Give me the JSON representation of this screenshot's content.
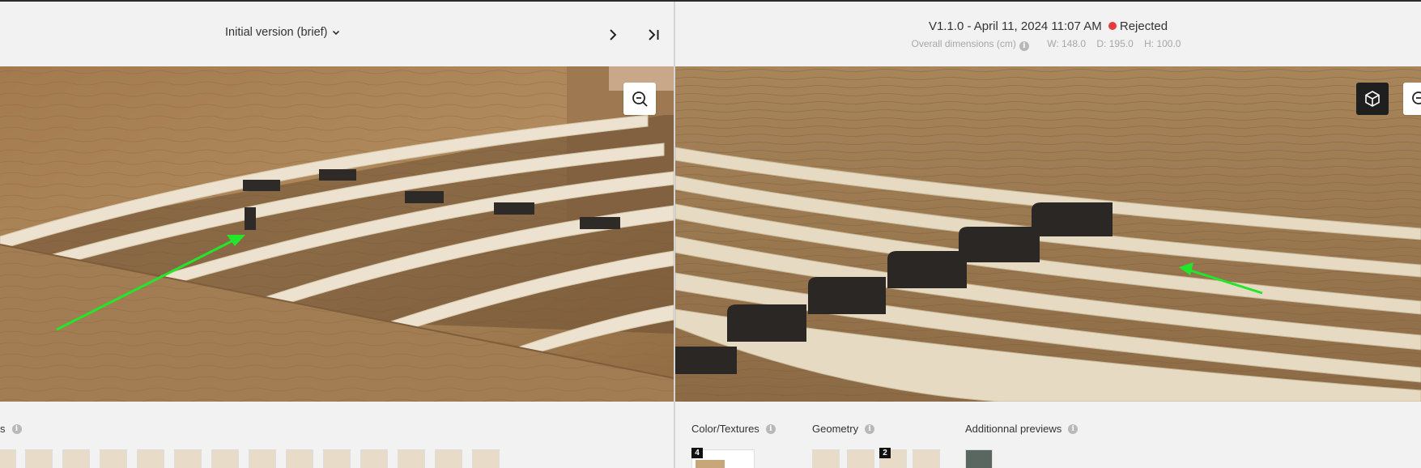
{
  "left_pane": {
    "version_label": "Initial version (brief)",
    "section_label_partial": "s",
    "thumbnail_count": 14
  },
  "right_pane": {
    "version": "V1.1.0 - April 11, 2024 11:07 AM",
    "status": "Rejected",
    "status_color": "#e83b3b",
    "dimensions_label": "Overall dimensions (cm)",
    "width": "W: 148.0",
    "depth": "D: 195.0",
    "height": "H: 100.0",
    "sections": {
      "color_textures": {
        "label": "Color/Textures",
        "badge": "4"
      },
      "geometry": {
        "label": "Geometry",
        "badge": "2"
      },
      "additional_previews": {
        "label": "Additionnal previews"
      }
    }
  },
  "colors": {
    "accent_arrow": "#22e62a",
    "wood": "#a98257",
    "slat": "#eadfcb",
    "bracket": "#2e2a27"
  },
  "icons": [
    "chevron-down-icon",
    "next-icon",
    "last-icon",
    "zoom-out-icon",
    "cube-icon",
    "info-icon"
  ]
}
